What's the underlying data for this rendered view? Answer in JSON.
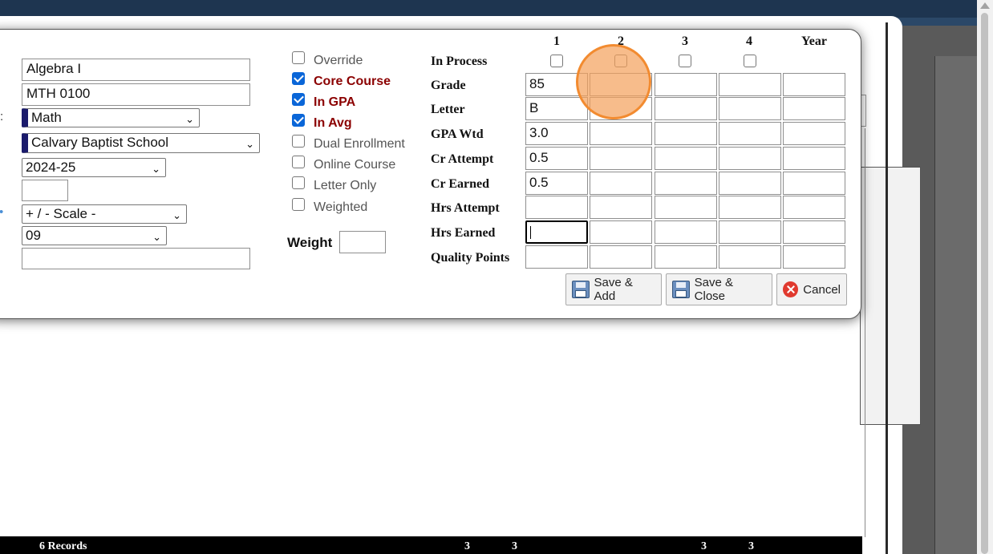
{
  "course": {
    "name": "Algebra I",
    "code": "MTH 0100",
    "department": "Math",
    "school": "Calvary Baptist School",
    "year": "2024-25",
    "small_field": "",
    "scale": "+ / - Scale -",
    "grade_level": "09",
    "notes": ""
  },
  "left_marks": {
    "dept_mark": ":",
    "scale_mark": "•"
  },
  "checkboxes": [
    {
      "label": "Override",
      "checked": false
    },
    {
      "label": "Core Course",
      "checked": true
    },
    {
      "label": "In GPA",
      "checked": true
    },
    {
      "label": "In Avg",
      "checked": true
    },
    {
      "label": "Dual Enrollment",
      "checked": false
    },
    {
      "label": "Online Course",
      "checked": false
    },
    {
      "label": "Letter Only",
      "checked": false
    },
    {
      "label": "Weighted",
      "checked": false
    }
  ],
  "weight": {
    "label": "Weight",
    "value": ""
  },
  "grid": {
    "columns": [
      "1",
      "2",
      "3",
      "4",
      "Year"
    ],
    "rows": [
      {
        "label": "In Process",
        "checkboxes": [
          false,
          false,
          false,
          false
        ]
      },
      {
        "label": "Grade",
        "values": [
          "85",
          "",
          "",
          "",
          ""
        ]
      },
      {
        "label": "Letter",
        "values": [
          "B",
          "",
          "",
          "",
          ""
        ]
      },
      {
        "label": "GPA Wtd",
        "values": [
          "3.0",
          "",
          "",
          "",
          ""
        ]
      },
      {
        "label": "Cr Attempt",
        "values": [
          "0.5",
          "",
          "",
          "",
          ""
        ]
      },
      {
        "label": "Cr Earned",
        "values": [
          "0.5",
          "",
          "",
          "",
          ""
        ]
      },
      {
        "label": "Hrs Attempt",
        "values": [
          "",
          "",
          "",
          "",
          ""
        ]
      },
      {
        "label": "Hrs Earned",
        "values": [
          "",
          "",
          "",
          "",
          ""
        ]
      },
      {
        "label": "Quality Points",
        "values": [
          "",
          "",
          "",
          "",
          ""
        ]
      }
    ]
  },
  "buttons": {
    "save_add": "Save & Add",
    "save_close": "Save & Close",
    "cancel": "Cancel"
  },
  "footer": {
    "records": "6 Records",
    "values": [
      "3",
      "3",
      "3",
      "3"
    ]
  },
  "icons": {
    "save": "floppy-disk-icon",
    "cancel": "cancel-x-icon"
  },
  "colors": {
    "checked_label": "#8b0000",
    "checkbox_checked": "#0a66d8",
    "cursor_highlight": "#f28b30"
  }
}
